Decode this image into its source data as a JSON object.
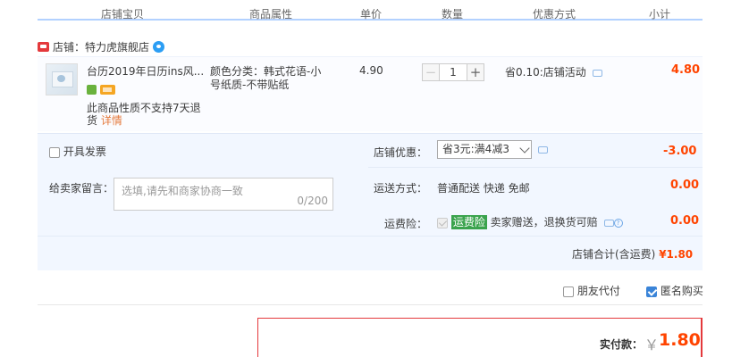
{
  "header": {
    "col_item": "店铺宝贝",
    "col_attr": "商品属性",
    "col_price": "单价",
    "col_qty": "数量",
    "col_discount": "优惠方式",
    "col_subtotal": "小计"
  },
  "shop": {
    "label": "店铺：",
    "name": "特力虎旗舰店"
  },
  "item": {
    "title": "台历2019年日历ins风...",
    "attr_line1": "颜色分类：韩式花语-小",
    "attr_line2": "号纸质-不带贴纸",
    "notice_line1": "此商品性质不支持7天退",
    "notice_line2": "货",
    "detail_link": "详情",
    "price": "4.90",
    "quantity": "1",
    "qty_minus": "−",
    "qty_plus": "+",
    "discount": "省0.10:店铺活动",
    "subtotal": "4.80"
  },
  "options": {
    "invoice_label": "开具发票",
    "shop_coupon_label": "店铺优惠：",
    "shop_coupon_value": "省3元:满4减3",
    "shop_coupon_amount": "-3.00",
    "message_label": "给卖家留言：",
    "message_placeholder": "选填,请先和商家协商一致",
    "message_count": "0/200",
    "shipping_label": "运送方式：",
    "shipping_value": "普通配送 快递 免邮",
    "shipping_amount": "0.00",
    "insurance_label": "运费险：",
    "insurance_tag": "运费险",
    "insurance_text": "卖家赠送，退换货可赔",
    "insurance_amount": "0.00",
    "shop_total_label": "店铺合计(含运费)",
    "shop_total_value": "¥1.80"
  },
  "footer": {
    "friend_pay_label": "朋友代付",
    "anonymous_label": "匿名购买",
    "pay_label": "实付款：",
    "pay_currency": "￥",
    "pay_amount": "1.80"
  },
  "colors": {
    "accent_red": "#f40",
    "header_border": "#b2d1ff",
    "panel_bg": "#f2f7ff"
  }
}
